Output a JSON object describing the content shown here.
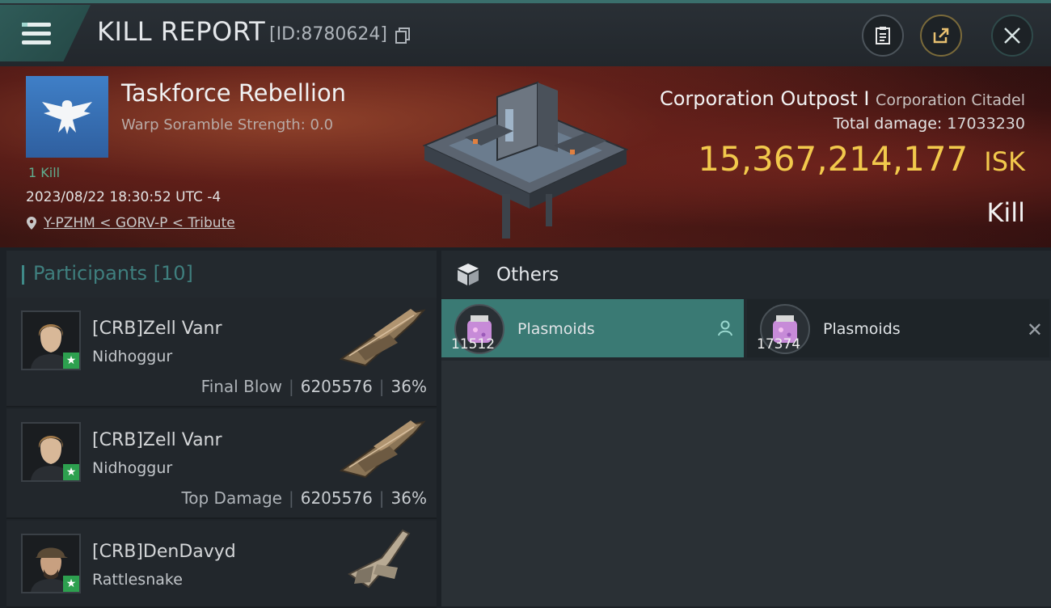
{
  "header": {
    "title": "KILL REPORT",
    "report_id": "[ID:8780624]"
  },
  "victim": {
    "corp_name": "Taskforce Rebellion",
    "warp_scramble": "Warp Soramble Strength: 0.0",
    "kill_count": "1 Kill",
    "datetime": "2023/08/22 18:30:52 UTC -4",
    "location": "Y-PZHM < GORV-P < Tribute",
    "target_name": "Corporation Outpost I",
    "target_class": "Corporation Citadel",
    "total_damage_label": "Total damage:",
    "total_damage": "17033230",
    "isk_value": "15,367,214,177",
    "isk_unit": "ISK",
    "result": "Kill"
  },
  "participants": {
    "label": "Participants [10]",
    "items": [
      {
        "name": "[CRB]Zell Vanr",
        "ship": "Nidhoggur",
        "role": "Final Blow",
        "damage": "6205576",
        "percent": "36%"
      },
      {
        "name": "[CRB]Zell Vanr",
        "ship": "Nidhoggur",
        "role": "Top Damage",
        "damage": "6205576",
        "percent": "36%"
      },
      {
        "name": "[CRB]DenDavyd",
        "ship": "Rattlesnake",
        "role": "",
        "damage": "",
        "percent": ""
      }
    ]
  },
  "others": {
    "label": "Others",
    "items": [
      {
        "name": "Plasmoids",
        "qty": "11512"
      },
      {
        "name": "Plasmoids",
        "qty": "17374"
      }
    ]
  },
  "colors": {
    "accent": "#3a7a74",
    "isk": "#f2c94c",
    "star": "#2da04f"
  }
}
